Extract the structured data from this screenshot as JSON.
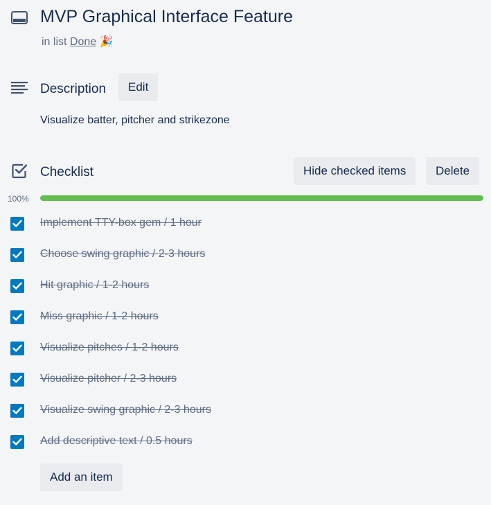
{
  "card": {
    "title": "MVP Graphical Interface Feature",
    "in_list_prefix": "in list",
    "list_name": "Done",
    "list_emoji": "🎉"
  },
  "description": {
    "title": "Description",
    "edit_label": "Edit",
    "text": "Visualize batter, pitcher and strikezone"
  },
  "checklist": {
    "title": "Checklist",
    "hide_label": "Hide checked items",
    "delete_label": "Delete",
    "progress_label": "100%",
    "progress": 1.0,
    "items": [
      {
        "text": "Implement TTY-box gem / 1 hour",
        "checked": true
      },
      {
        "text": "Choose swing graphic / 2-3 hours",
        "checked": true
      },
      {
        "text": "Hit graphic / 1-2 hours",
        "checked": true
      },
      {
        "text": "Miss graphic / 1-2 hours",
        "checked": true
      },
      {
        "text": "Visualize pitches / 1-2 hours",
        "checked": true
      },
      {
        "text": "Visualize pitcher / 2-3 hours",
        "checked": true
      },
      {
        "text": "Visualize swing graphic / 2-3 hours",
        "checked": true
      },
      {
        "text": "Add descriptive text / 0.5 hours",
        "checked": true
      }
    ],
    "add_label": "Add an item"
  },
  "colors": {
    "accent": "#0079bf",
    "progress": "#61bd4f",
    "text": "#172b4d",
    "muted": "#5e6c84"
  }
}
